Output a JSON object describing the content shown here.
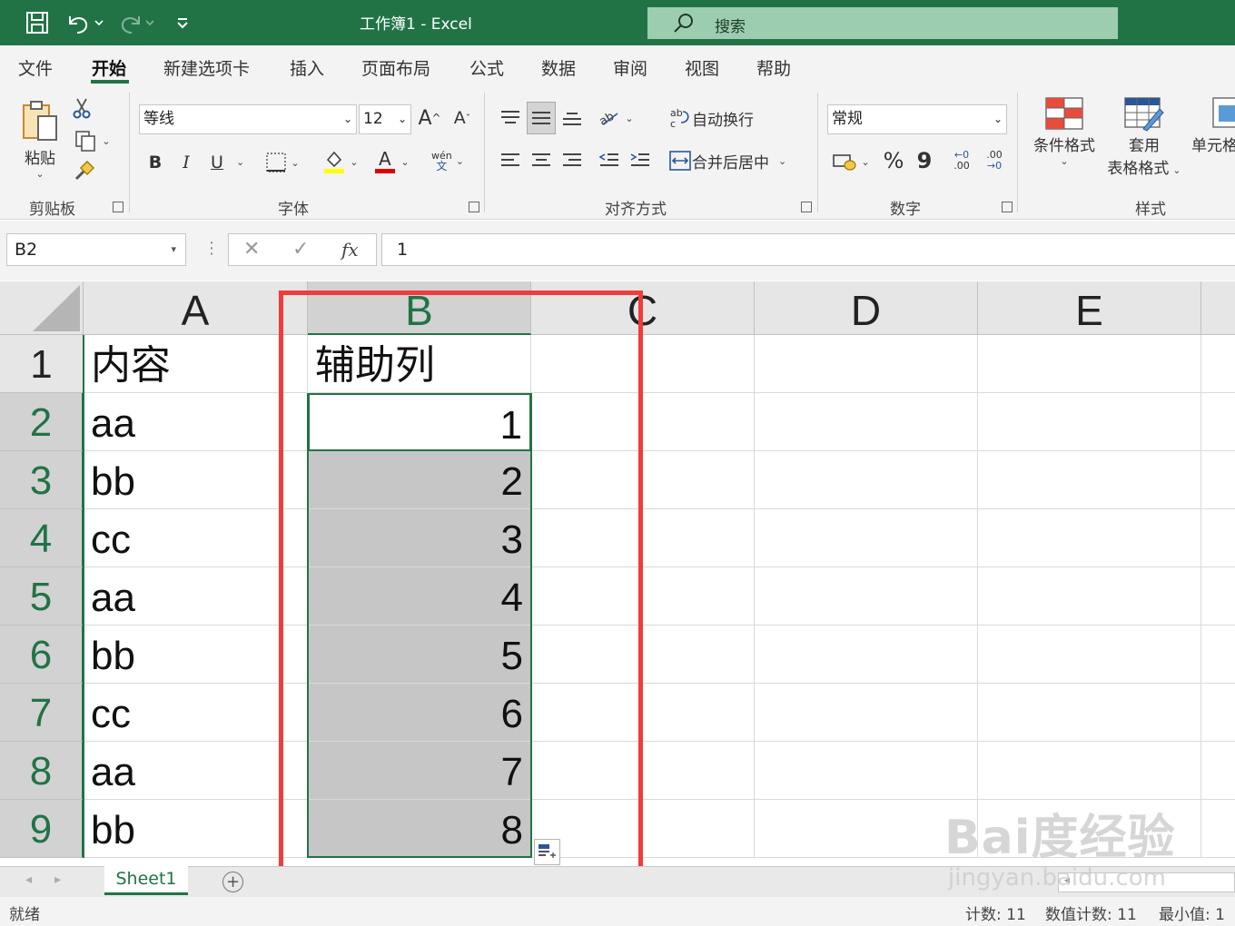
{
  "titlebar": {
    "title": "工作簿1  -  Excel",
    "search_placeholder": "搜索"
  },
  "menu": {
    "tabs": [
      "文件",
      "开始",
      "新建选项卡",
      "插入",
      "页面布局",
      "公式",
      "数据",
      "审阅",
      "视图",
      "帮助"
    ],
    "active": "开始"
  },
  "ribbon": {
    "clipboard": {
      "label": "剪贴板",
      "paste": "粘贴"
    },
    "font": {
      "label": "字体",
      "name": "等线",
      "size": "12",
      "bold": "B",
      "italic": "I",
      "underline": "U",
      "font_color_glyph": "A",
      "grow": "A",
      "shrink": "A",
      "wen_top": "wén",
      "wen_bottom": "文"
    },
    "alignment": {
      "label": "对齐方式",
      "wrap": "自动换行",
      "merge": "合并后居中"
    },
    "number": {
      "label": "数字",
      "format": "常规",
      "percent": "%",
      "comma": "9",
      "inc_decimal_top": "←0",
      "inc_decimal_bottom": ".00",
      "dec_decimal_top": ".00",
      "dec_decimal_bottom": "→0"
    },
    "styles": {
      "label": "样式",
      "conditional": "条件格式",
      "table_top": "套用",
      "table_bottom": "表格格式",
      "cell_styles": "单元格"
    }
  },
  "formula_bar": {
    "name_box": "B2",
    "fx": "fx",
    "cancel": "✕",
    "enter": "✓",
    "value": "1"
  },
  "grid": {
    "columns": [
      "A",
      "B",
      "C",
      "D",
      "E"
    ],
    "selected_column": "B",
    "rows": [
      {
        "n": "1",
        "a": "内容",
        "b": "辅助列"
      },
      {
        "n": "2",
        "a": "aa",
        "b": "1"
      },
      {
        "n": "3",
        "a": "bb",
        "b": "2"
      },
      {
        "n": "4",
        "a": "cc",
        "b": "3"
      },
      {
        "n": "5",
        "a": "aa",
        "b": "4"
      },
      {
        "n": "6",
        "a": "bb",
        "b": "5"
      },
      {
        "n": "7",
        "a": "cc",
        "b": "6"
      },
      {
        "n": "8",
        "a": "aa",
        "b": "7"
      },
      {
        "n": "9",
        "a": "bb",
        "b": "8"
      }
    ],
    "active_cell": "B2",
    "selected_range": "B2:B9"
  },
  "sheets": {
    "tabs": [
      "Sheet1"
    ],
    "active": "Sheet1",
    "add": "+"
  },
  "status": {
    "mode": "就绪",
    "count": "计数: 11",
    "numeric_count": "数值计数: 11",
    "min": "最小值: 1"
  },
  "watermark": {
    "brand": "Bai度经验",
    "url": "jingyan.baidu.com"
  },
  "colors": {
    "accent": "#217346",
    "annotation": "#f03c3c",
    "selection": "#c6c6c6"
  }
}
